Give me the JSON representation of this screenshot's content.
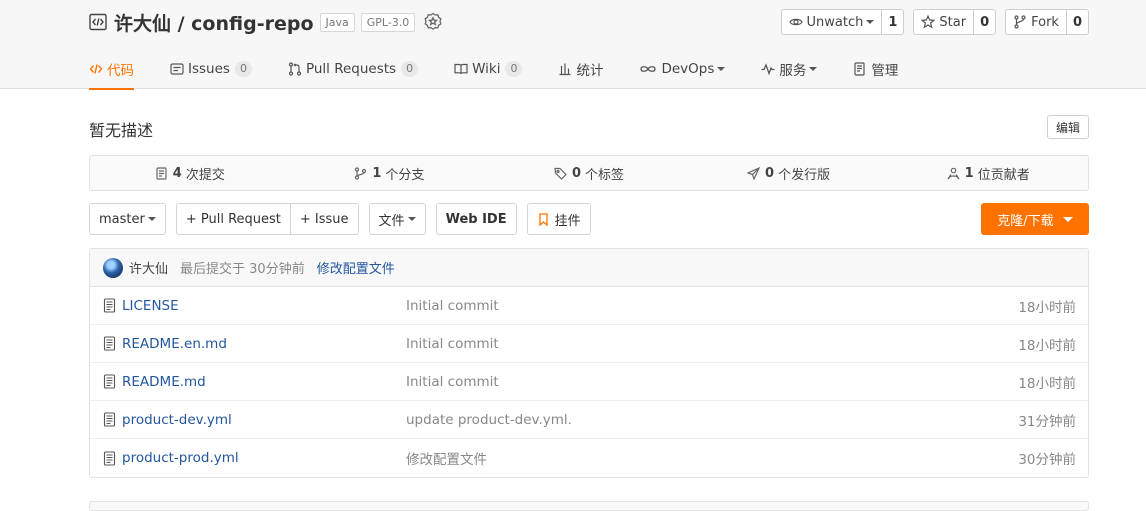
{
  "repo": {
    "title": "许大仙 / config-repo",
    "tags": [
      "Java",
      "GPL-3.0"
    ]
  },
  "actions": [
    {
      "label": "Unwatch",
      "count": "1"
    },
    {
      "label": "Star",
      "count": "0"
    },
    {
      "label": "Fork",
      "count": "0"
    }
  ],
  "tabs": [
    {
      "label": "代码"
    },
    {
      "label": "Issues",
      "count": "0"
    },
    {
      "label": "Pull Requests",
      "count": "0"
    },
    {
      "label": "Wiki",
      "count": "0"
    },
    {
      "label": "统计"
    },
    {
      "label": "DevOps"
    },
    {
      "label": "服务"
    },
    {
      "label": "管理"
    }
  ],
  "description": "暂无描述",
  "edit_label": "编辑",
  "stats": [
    {
      "num": "4",
      "label": "次提交"
    },
    {
      "num": "1",
      "label": "个分支"
    },
    {
      "num": "0",
      "label": "个标签"
    },
    {
      "num": "0",
      "label": "个发行版"
    },
    {
      "num": "1",
      "label": "位贡献者"
    }
  ],
  "toolbar": {
    "branch": "master",
    "pull_request": "+ Pull Request",
    "issue": "+ Issue",
    "files": "文件",
    "web_ide": "Web IDE",
    "widget": "挂件",
    "clone": "克隆/下载"
  },
  "last_commit": {
    "author": "许大仙",
    "meta": "最后提交于 30分钟前",
    "message": "修改配置文件"
  },
  "files": [
    {
      "name": "LICENSE",
      "message": "Initial commit",
      "time": "18小时前"
    },
    {
      "name": "README.en.md",
      "message": "Initial commit",
      "time": "18小时前"
    },
    {
      "name": "README.md",
      "message": "Initial commit",
      "time": "18小时前"
    },
    {
      "name": "product-dev.yml",
      "message": "update product-dev.yml.",
      "time": "31分钟前"
    },
    {
      "name": "product-prod.yml",
      "message": "修改配置文件",
      "time": "30分钟前"
    }
  ],
  "colors": {
    "accent": "#fe7300",
    "link": "#24579e"
  }
}
